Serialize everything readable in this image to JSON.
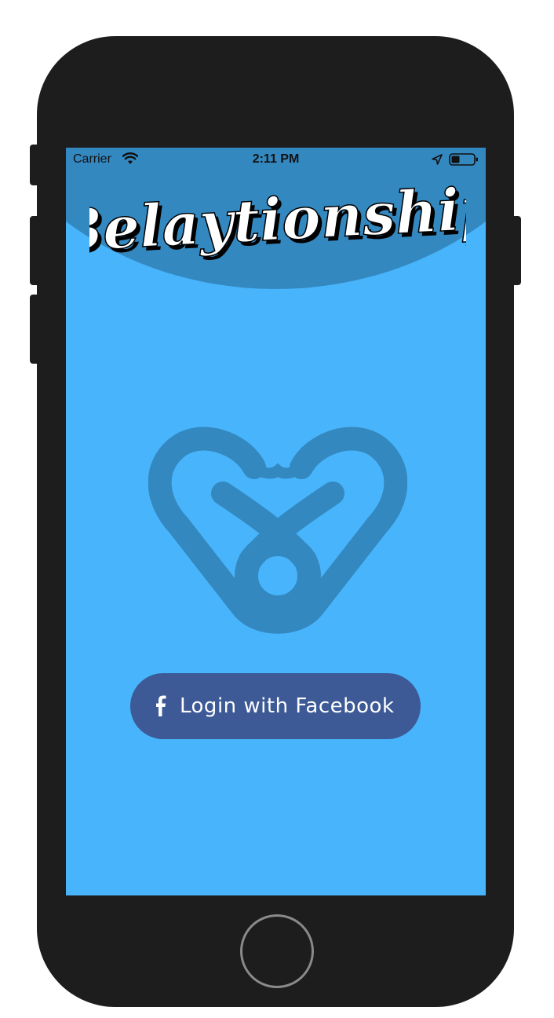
{
  "status_bar": {
    "carrier": "Carrier",
    "time": "2:11 PM"
  },
  "app": {
    "title": "Belaytionship"
  },
  "login": {
    "facebook_label": "Login with Facebook",
    "facebook_icon_glyph": "f"
  },
  "icons": {
    "wifi": "wifi-icon",
    "location": "location-arrow-icon",
    "battery": "battery-icon",
    "logo": "heart-rope-logo-icon",
    "facebook": "facebook-icon"
  },
  "colors": {
    "screen_bg": "#48b4fb",
    "header_bg": "#3488c0",
    "logo": "#3488c0",
    "facebook_button": "#3d5a96",
    "phone_body": "#1d1d1d"
  }
}
